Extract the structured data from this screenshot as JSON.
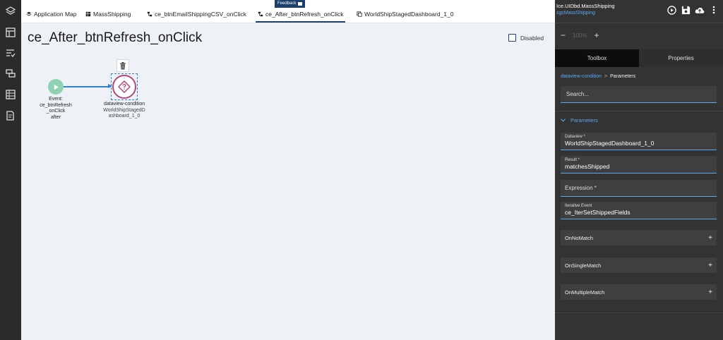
{
  "rail": {
    "icons": [
      "layers-icon",
      "layout-icon",
      "checklist-icon",
      "transfer-icon",
      "grid-icon",
      "form-edit-icon"
    ]
  },
  "feedback": {
    "label": "Feedback"
  },
  "tabs": [
    {
      "label": "Application Map",
      "icon": "layers-icon"
    },
    {
      "label": "MassShipping",
      "icon": "grid-icon"
    },
    {
      "label": "ce_btnEmailShippingCSV_onClick",
      "icon": "workflow-icon"
    },
    {
      "label": "ce_After_btnRefresh_onClick",
      "icon": "workflow-icon",
      "active": true
    },
    {
      "label": "WorldShipStagedDashboard_1_0",
      "icon": "copy-icon"
    }
  ],
  "canvas": {
    "title": "ce_After_btnRefresh_onClick",
    "disabled_label": "Disabled",
    "event_node": {
      "lines": [
        "Event:",
        "ce_btnRefresh",
        "_onClick",
        "after"
      ]
    },
    "condition_node": {
      "type_label": "dataview-condition",
      "name_lines": [
        "WorldShipStagedD",
        "ashboard_1_0"
      ]
    }
  },
  "panel": {
    "title": "Ice.UIDbd.MassShipping",
    "subtitle": "sgcMassShipping",
    "zoom": {
      "minus": "−",
      "value": "100%",
      "plus": "+"
    },
    "tabs": {
      "toolbox": "Toolbox",
      "properties": "Properties"
    },
    "breadcrumb": {
      "link": "dataview-condition",
      "separator": ">",
      "current": "Parameters"
    },
    "search_placeholder": "Search...",
    "section_label": "Parameters",
    "fields": [
      {
        "label": "Dataview *",
        "value": "WorldShipStagedDashboard_1_0"
      },
      {
        "label": "Result *",
        "value": "matchesShipped"
      },
      {
        "label": "Expression *",
        "value": ""
      },
      {
        "label": "Iterative Event",
        "value": "ce_IterSetShippedFields"
      }
    ],
    "expanders": [
      {
        "label": "OnNoMatch",
        "icon": "+"
      },
      {
        "label": "OnSingleMatch",
        "icon": "+"
      },
      {
        "label": "OnMultipleMatch",
        "icon": "+"
      }
    ]
  },
  "colors": {
    "accent": "#1c3f6e",
    "link": "#5aa7f0",
    "event_node": "#8fd1b4",
    "condition_border": "#b5467a",
    "connector": "#2f7fd6"
  }
}
